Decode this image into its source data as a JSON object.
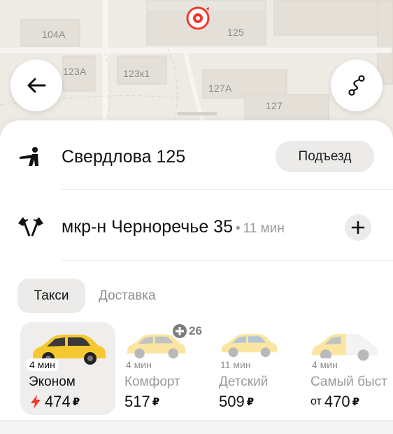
{
  "map": {
    "building_labels": [
      "104А",
      "123А",
      "123к1",
      "125",
      "127А",
      "127"
    ],
    "back_button_icon": "arrow-left-icon",
    "route_button_icon": "route-icon",
    "pin_icon": "location-pin-icon"
  },
  "route": {
    "from": {
      "icon": "person-hail-icon",
      "address": "Свердлова 125",
      "entrance_label": "Подъезд"
    },
    "to": {
      "icon": "finish-flags-icon",
      "address": "мкр-н Черноречье 35",
      "separator": "•",
      "eta": "11 мин",
      "add_icon": "plus-icon"
    }
  },
  "tabs": [
    {
      "label": "Такси",
      "active": true
    },
    {
      "label": "Доставка",
      "active": false
    }
  ],
  "tariffs": [
    {
      "time": "4 мин",
      "name": "Эконом",
      "price_prefix": "",
      "price": "474",
      "currency": "₽",
      "surge": true,
      "selected": true
    },
    {
      "time": "4 мин",
      "name": "Комфорт",
      "price_prefix": "",
      "price": "517",
      "currency": "₽",
      "surge": false,
      "selected": false
    },
    {
      "time": "11 мин",
      "name": "Детский",
      "price_prefix": "",
      "price": "509",
      "currency": "₽",
      "surge": false,
      "selected": false
    },
    {
      "time": "4 мин",
      "name": "Самый быст",
      "price_prefix": "от",
      "price": "470",
      "currency": "₽",
      "surge": false,
      "selected": false
    }
  ],
  "plus_badge": {
    "icon": "plus-points-icon",
    "value": "26"
  },
  "colors": {
    "accent_red": "#f03a2e",
    "taxi_yellow": "#f5c830",
    "chip_bg": "#ecebe9"
  }
}
